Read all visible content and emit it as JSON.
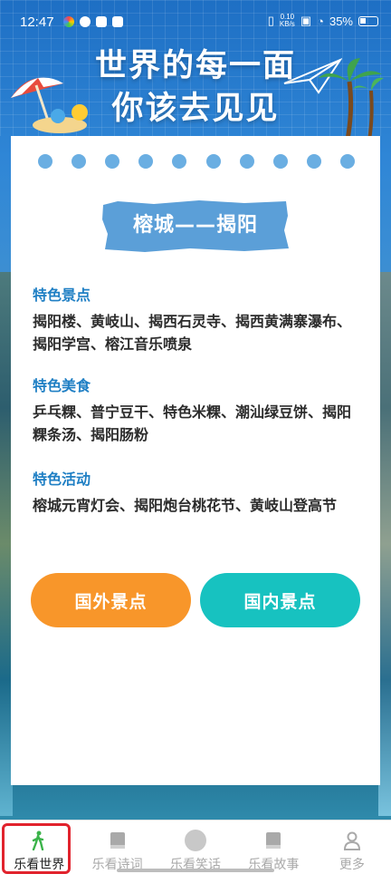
{
  "status_bar": {
    "time": "12:47",
    "net_speed_value": "0.10",
    "net_speed_unit": "KB/s",
    "battery": "35%"
  },
  "header": {
    "title_line1": "世界的每一面",
    "title_line2": "你该去见见"
  },
  "card": {
    "city": "榕城——揭阳",
    "sections": [
      {
        "heading": "特色景点",
        "body": "揭阳楼、黄岐山、揭西石灵寺、揭西黄满寨瀑布、揭阳学宫、榕江音乐喷泉"
      },
      {
        "heading": "特色美食",
        "body": "乒乓粿、普宁豆干、特色米粿、潮汕绿豆饼、揭阳粿条汤、揭阳肠粉"
      },
      {
        "heading": "特色活动",
        "body": "榕城元宵灯会、揭阳炮台桃花节、黄岐山登高节"
      }
    ],
    "buttons": {
      "international": "国外景点",
      "domestic": "国内景点"
    }
  },
  "tabs": [
    {
      "label": "乐看世界",
      "icon": "walking-person-icon",
      "active": true
    },
    {
      "label": "乐看诗词",
      "icon": "book-icon",
      "active": false
    },
    {
      "label": "乐看笑话",
      "icon": "circle-icon",
      "active": false
    },
    {
      "label": "乐看故事",
      "icon": "book-icon",
      "active": false
    },
    {
      "label": "更多",
      "icon": "user-icon",
      "active": false
    }
  ],
  "colors": {
    "accent_blue": "#1f7fc4",
    "orange_button": "#f8962a",
    "teal_button": "#17c2c0",
    "active_tab_highlight": "#e1232d"
  }
}
